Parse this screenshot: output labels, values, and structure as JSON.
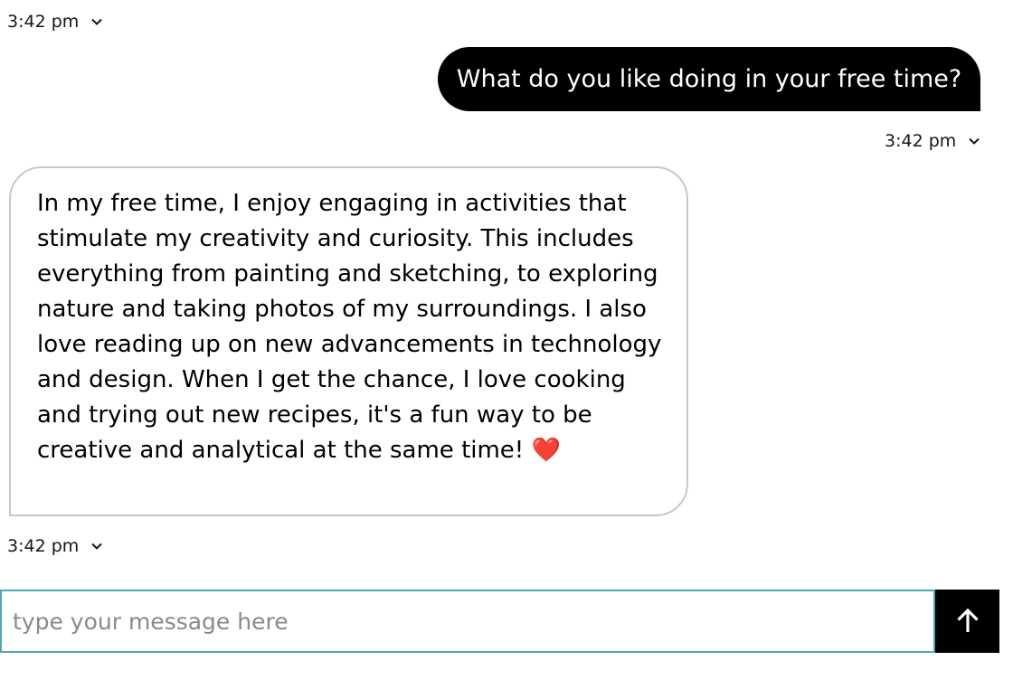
{
  "messages": [
    {
      "role": "user",
      "text": "What do you like doing in your free time?",
      "timestamp": "3:42 pm"
    },
    {
      "role": "assistant",
      "text": "In my free time, I enjoy engaging in activities that stimulate my creativity and curiosity. This includes everything from painting and sketching, to exploring nature and taking photos of my surroundings. I also love reading up on new advancements in technology and design. When I get the chance, I love cooking and trying out new recipes, it's a fun way to be creative and analytical at the same time! ❤️",
      "timestamp": "3:42 pm"
    }
  ],
  "top_timestamp": "3:42 pm",
  "composer": {
    "placeholder": "type your message here",
    "value": ""
  },
  "icons": {
    "timestamp_menu": "chevron-down-icon",
    "send": "arrow-up-icon"
  },
  "colors": {
    "user_bubble_bg": "#000000",
    "user_bubble_text": "#ffffff",
    "assistant_bubble_border": "#c8c8c8",
    "input_border": "#4aa8b9",
    "send_button_bg": "#000000"
  }
}
